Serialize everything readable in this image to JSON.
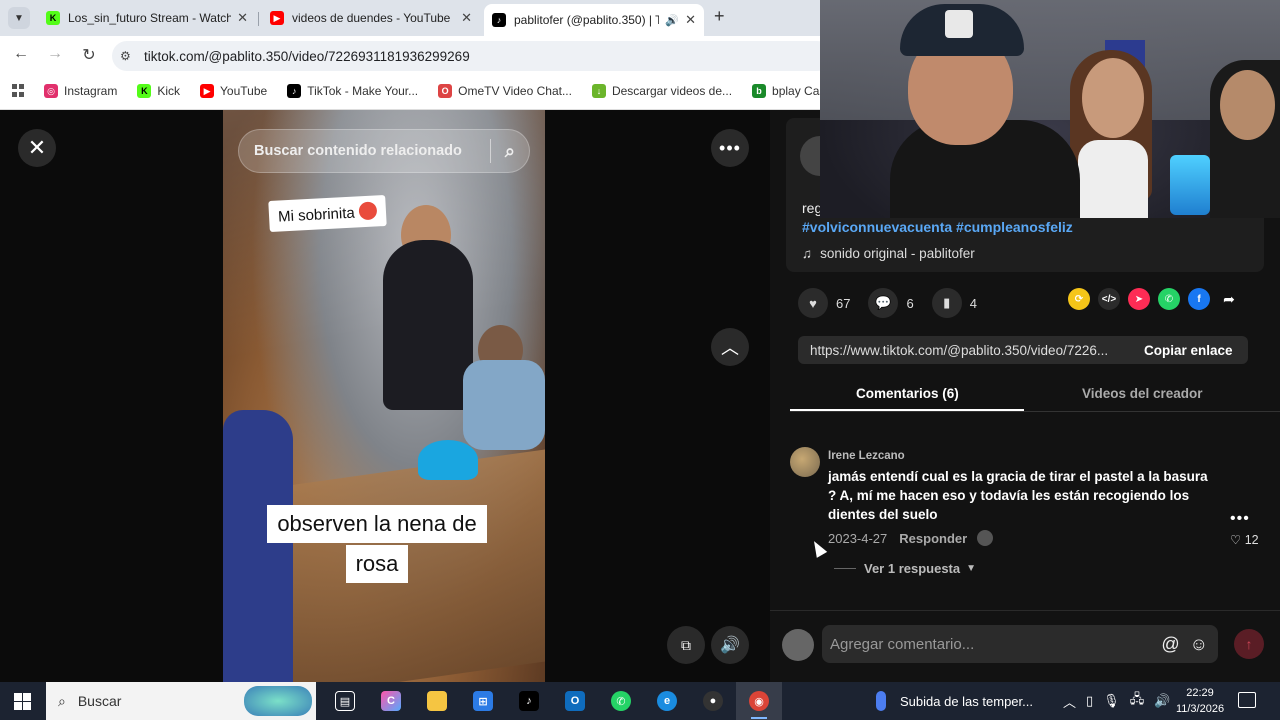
{
  "browser": {
    "tabs": [
      {
        "title": "Los_sin_futuro Stream - Watch",
        "favicon": "kick-icon",
        "color": "#53fc18"
      },
      {
        "title": "videos de duendes - YouTube",
        "favicon": "youtube-icon",
        "color": "#ff0000"
      },
      {
        "title": "pablitofer (@pablito.350) | T",
        "favicon": "tiktok-icon",
        "color": "#000000"
      }
    ],
    "url": "tiktok.com/@pablito.350/video/7226931181936299269",
    "bookmarks": [
      {
        "label": "Instagram",
        "color": "#e1306c"
      },
      {
        "label": "Kick",
        "color": "#53fc18"
      },
      {
        "label": "YouTube",
        "color": "#ff0000"
      },
      {
        "label": "TikTok - Make Your...",
        "color": "#000000"
      },
      {
        "label": "OmeTV Video Chat...",
        "color": "#d44"
      },
      {
        "label": "Descargar videos de...",
        "color": "#6bb52b"
      },
      {
        "label": "bplay Casino - Pl",
        "color": "#1a8a2a"
      }
    ]
  },
  "video": {
    "search_placeholder": "Buscar contenido relacionado",
    "caption_top": "Mi sobrinita",
    "caption_bottom_line1": "observen la nena de",
    "caption_bottom_line2": "rosa"
  },
  "post": {
    "desc_partial": "reg",
    "hashtags": "#volviconnuevacuenta #cumpleanosfeliz",
    "sound": "sonido original - pablitofer",
    "likes": "67",
    "comments": "6",
    "saves": "4",
    "link": "https://www.tiktok.com/@pablito.350/video/7226...",
    "copy_label": "Copiar enlace"
  },
  "tabs": {
    "comments": "Comentarios (6)",
    "creator": "Videos del creador"
  },
  "comment": {
    "user": "Irene Lezcano",
    "text": "jamás entendí cual es la gracia de tirar el pastel a la basura ? A, mí me hacen eso y todavía les están recogiendo los dientes del suelo",
    "date": "2023-4-27",
    "reply": "Responder",
    "likes": "12",
    "view_replies": "Ver 1 respuesta"
  },
  "comment_bar": {
    "placeholder": "Agregar comentario..."
  },
  "taskbar": {
    "search": "Buscar",
    "weather": "Subida de las temper...",
    "time": "22:29",
    "date": "11/3/2026"
  }
}
